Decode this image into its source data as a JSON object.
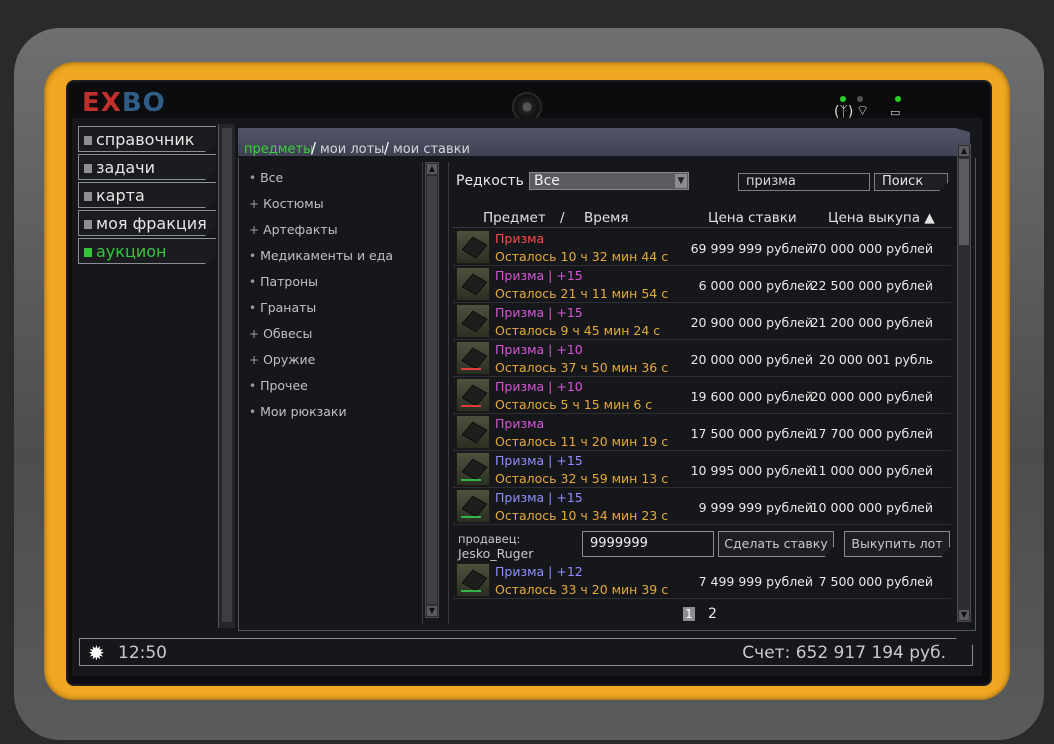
{
  "device": {
    "logo_left": "EX",
    "logo_right": "BO"
  },
  "sidebar": {
    "items": [
      {
        "label": "справочник",
        "active": false
      },
      {
        "label": "задачи",
        "active": false
      },
      {
        "label": "карта",
        "active": false
      },
      {
        "label": "моя фракция",
        "active": false
      },
      {
        "label": "аукцион",
        "active": true
      }
    ]
  },
  "tabs": [
    {
      "label": "предметы",
      "active": true
    },
    {
      "label": "мои лоты",
      "active": false
    },
    {
      "label": "мои ставки",
      "active": false
    }
  ],
  "categories": [
    {
      "bullet": "•",
      "label": "Все"
    },
    {
      "bullet": "+",
      "label": "Костюмы"
    },
    {
      "bullet": "+",
      "label": "Артефакты"
    },
    {
      "bullet": "•",
      "label": "Медикаменты и еда"
    },
    {
      "bullet": "•",
      "label": "Патроны"
    },
    {
      "bullet": "•",
      "label": "Гранаты"
    },
    {
      "bullet": "+",
      "label": "Обвесы"
    },
    {
      "bullet": "+",
      "label": "Оружие"
    },
    {
      "bullet": "•",
      "label": "Прочее"
    },
    {
      "bullet": "•",
      "label": "Мои рюкзаки"
    }
  ],
  "filters": {
    "rarity_label": "Редкость",
    "rarity_value": "Все",
    "search_value": "призма",
    "search_button": "Поиск"
  },
  "columns": {
    "item": "Предмет",
    "sep": "/",
    "time": "Время",
    "bid": "Цена ставки",
    "buyout": "Цена выкупа ▲"
  },
  "lots": [
    {
      "name": "Призма",
      "name_color": "#ff4a4a",
      "time_left": "Осталось 10 ч 32 мин 44 с",
      "bid": "69 999 999 рублей",
      "buyout": "70 000 000 рублей",
      "tag_color": ""
    },
    {
      "name": "Призма | +15",
      "name_color": "#d655d6",
      "time_left": "Осталось 21 ч 11 мин 54 с",
      "bid": "6 000 000 рублей",
      "buyout": "22 500 000 рублей",
      "tag_color": ""
    },
    {
      "name": "Призма | +15",
      "name_color": "#d655d6",
      "time_left": "Осталось 9 ч 45 мин 24 с",
      "bid": "20 900 000 рублей",
      "buyout": "21 200 000 рублей",
      "tag_color": ""
    },
    {
      "name": "Призма | +10",
      "name_color": "#d655d6",
      "time_left": "Осталось 37 ч 50 мин 36 с",
      "bid": "20 000 000 рублей",
      "buyout": "20 000 001 рубль",
      "tag_color": "#e23b3b"
    },
    {
      "name": "Призма | +10",
      "name_color": "#d655d6",
      "time_left": "Осталось 5 ч 15 мин 6 с",
      "bid": "19 600 000 рублей",
      "buyout": "20 000 000 рублей",
      "tag_color": "#e23b3b"
    },
    {
      "name": "Призма",
      "name_color": "#d655d6",
      "time_left": "Осталось 11 ч 20 мин 19 с",
      "bid": "17 500 000 рублей",
      "buyout": "17 700 000 рублей",
      "tag_color": ""
    },
    {
      "name": "Призма | +15",
      "name_color": "#8e8eff",
      "time_left": "Осталось 32 ч 59 мин 13 с",
      "bid": "10 995 000 рублей",
      "buyout": "11 000 000 рублей",
      "tag_color": "#2fb54a"
    },
    {
      "name": "Призма | +15",
      "name_color": "#8e8eff",
      "time_left": "Осталось 10 ч 34 мин 23 с",
      "bid": "9 999 999 рублей",
      "buyout": "10 000 000 рублей",
      "tag_color": "#2fb54a"
    },
    {
      "name": "Призма | +12",
      "name_color": "#8e8eff",
      "time_left": "Осталось 33 ч 20 мин 39 с",
      "bid": "7 499 999 рублей",
      "buyout": "7 500 000 рублей",
      "tag_color": "#2fb54a"
    }
  ],
  "selected_lot": {
    "seller_label": "продавец:",
    "seller_name": "Jesko_Ruger",
    "bid_input": "9999999",
    "bid_button": "Сделать ставку",
    "buyout_button": "Выкупить лот"
  },
  "pagination": {
    "pages": [
      "1",
      "2"
    ],
    "current": "1"
  },
  "statusbar": {
    "time": "12:50",
    "balance": "Счет: 652 917 194 руб."
  }
}
